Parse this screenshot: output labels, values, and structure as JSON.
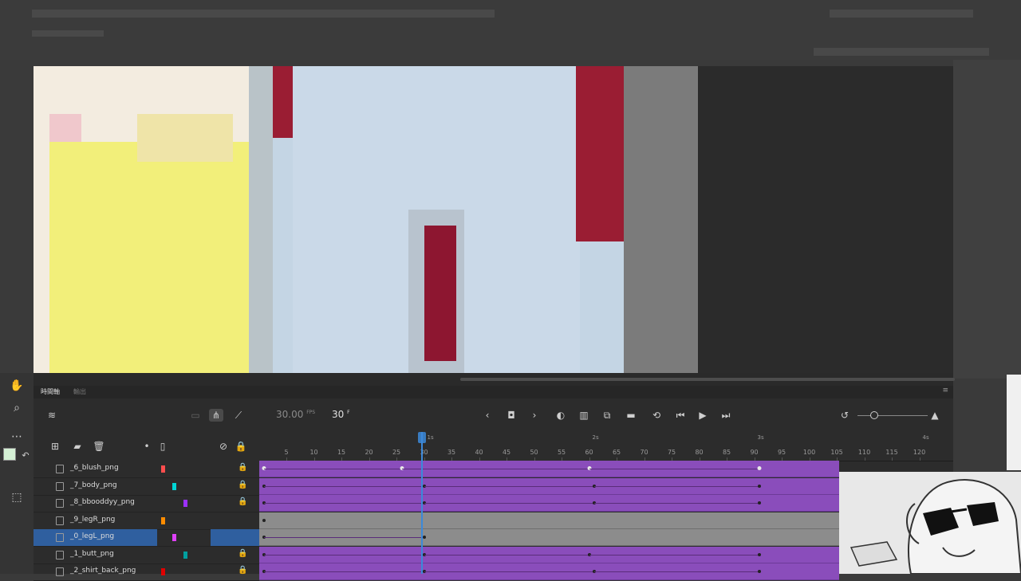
{
  "timeline": {
    "tabs": [
      {
        "label": "時間軸",
        "active": true
      },
      {
        "label": "輸出",
        "active": false
      }
    ],
    "fps_value": "30.00",
    "fps_unit": "FPS",
    "current_frame": "30",
    "frame_unit": "F",
    "ruler": {
      "frame_numbers": [
        "5",
        "10",
        "15",
        "20",
        "25",
        "30",
        "35",
        "40",
        "45",
        "50",
        "55",
        "60",
        "65",
        "70",
        "75",
        "80",
        "85",
        "90",
        "95",
        "100",
        "105",
        "110",
        "115",
        "120"
      ],
      "seconds": [
        "1s",
        "2s",
        "3s",
        "4s"
      ]
    },
    "layers": [
      {
        "name": "_6_blush_png",
        "locked": true,
        "color": "#ff4d4d",
        "selected": false,
        "track": "purple",
        "keyframes": [
          1,
          26,
          60,
          91
        ]
      },
      {
        "name": "_7_body_png",
        "locked": true,
        "color": "#00d6d6",
        "selected": false,
        "track": "purple",
        "keyframes": [
          1,
          30,
          61,
          91
        ]
      },
      {
        "name": "_8_bbooddyy_png",
        "locked": true,
        "color": "#9b30ff",
        "selected": false,
        "track": "purple",
        "keyframes": [
          1,
          30,
          61,
          91
        ]
      },
      {
        "name": "_9_legR_png",
        "locked": false,
        "color": "#ff8c00",
        "selected": false,
        "track": "gray",
        "keyframes": [
          1
        ]
      },
      {
        "name": "_0_legL_png",
        "locked": false,
        "color": "#e040fb",
        "selected": true,
        "track": "gray",
        "keyframes": [
          1,
          30
        ]
      },
      {
        "name": "_1_butt_png",
        "locked": true,
        "color": "#00a0a0",
        "selected": false,
        "track": "purple",
        "keyframes": [
          1,
          30,
          60,
          91
        ]
      },
      {
        "name": "_2_shirt_back_png",
        "locked": true,
        "color": "#e00000",
        "selected": false,
        "track": "purple",
        "keyframes": [
          1,
          30,
          61,
          91
        ]
      }
    ]
  },
  "colors": {
    "track_purple": "#8a4dbb",
    "track_gray": "#8c8c8c",
    "selection": "#2f5f9f",
    "playhead": "#3c89d9"
  }
}
